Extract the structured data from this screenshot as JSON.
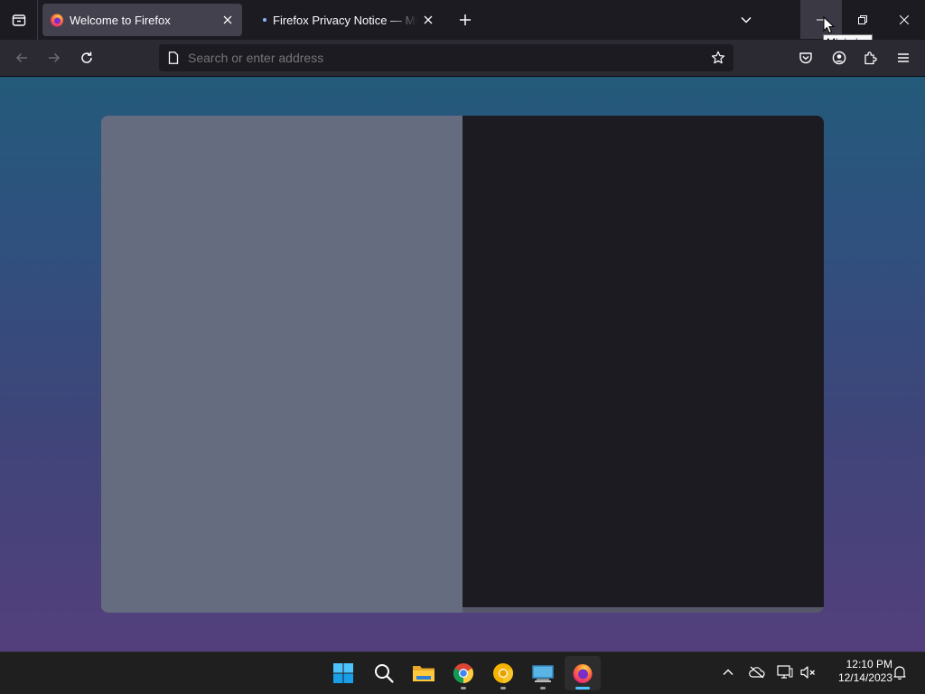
{
  "browser": {
    "tabs": [
      {
        "title": "Welcome to Firefox",
        "active": true,
        "icon": "firefox-favicon"
      },
      {
        "title": "Firefox Privacy Notice — Mozilla",
        "active": false,
        "icon": "loading-dot"
      }
    ],
    "urlbar": {
      "placeholder": "Search or enter address",
      "value": ""
    },
    "window_controls": {
      "tooltip": "Minimize"
    }
  },
  "content": {
    "background_gradient": [
      "#235a7a",
      "#533f7c"
    ],
    "modal": {
      "left_color": "#666c80",
      "right_color": "#1c1b22"
    }
  },
  "taskbar": {
    "apps": [
      "start-icon",
      "search-icon",
      "file-explorer-icon",
      "chrome-icon",
      "chrome-canary-icon",
      "terminal-icon",
      "firefox-icon"
    ],
    "tray": [
      "chevron-up-icon",
      "onedrive-offline-icon",
      "network-icon",
      "volume-muted-icon",
      "notification-bell-icon"
    ],
    "clock": {
      "time": "12:10 PM",
      "date": "12/14/2023"
    }
  }
}
